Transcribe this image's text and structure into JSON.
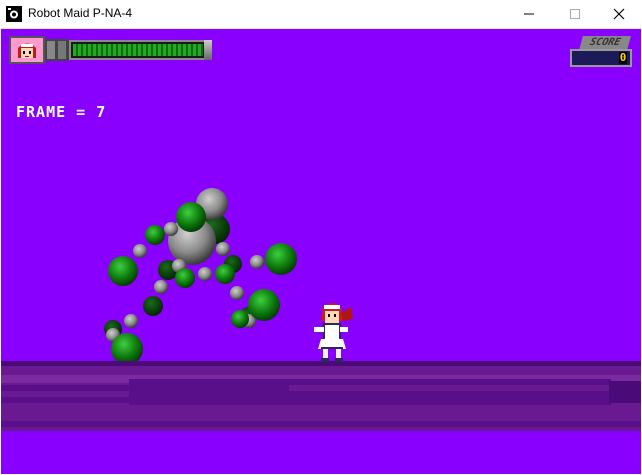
{
  "window": {
    "title": "Robot Maid P-NA-4",
    "icon": "camera-app-icon",
    "controls": [
      "minimize-icon",
      "maximize-icon",
      "close-icon"
    ]
  },
  "hud": {
    "health_percent": 100,
    "score_label": "SCORE",
    "score_value": "0",
    "colors": {
      "health": "#22aa22",
      "score_digit": "#ffd800"
    }
  },
  "debug": {
    "frame_text": "FRAME = 7"
  },
  "scene": {
    "background": "#8a00ff",
    "floor_color": "#6a1a90",
    "characters": [
      "boss-orb-cluster",
      "robot-maid-player"
    ]
  }
}
